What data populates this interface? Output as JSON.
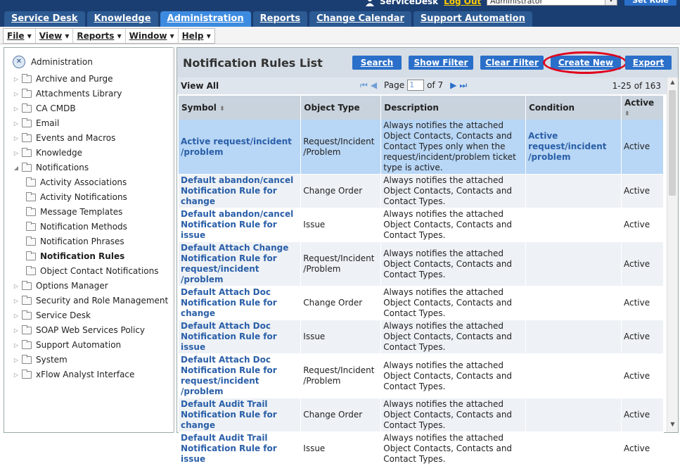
{
  "top": {
    "user": "ServiceDesk",
    "logout": "Log Out",
    "role": "Administrator",
    "set_role": "Set Role"
  },
  "tabs": [
    "Service Desk",
    "Knowledge",
    "Administration",
    "Reports",
    "Change Calendar",
    "Support Automation"
  ],
  "active_tab": "Administration",
  "menus": [
    "File",
    "View",
    "Reports",
    "Window",
    "Help"
  ],
  "sidebar": {
    "root": "Administration",
    "items": [
      {
        "label": "Archive and Purge",
        "level": 1
      },
      {
        "label": "Attachments Library",
        "level": 1
      },
      {
        "label": "CA CMDB",
        "level": 1
      },
      {
        "label": "Email",
        "level": 1
      },
      {
        "label": "Events and Macros",
        "level": 1
      },
      {
        "label": "Knowledge",
        "level": 1
      },
      {
        "label": "Notifications",
        "level": 1,
        "expanded": true
      },
      {
        "label": "Activity Associations",
        "level": 2
      },
      {
        "label": "Activity Notifications",
        "level": 2
      },
      {
        "label": "Message Templates",
        "level": 2
      },
      {
        "label": "Notification Methods",
        "level": 2
      },
      {
        "label": "Notification Phrases",
        "level": 2
      },
      {
        "label": "Notification Rules",
        "level": 2,
        "selected": true
      },
      {
        "label": "Object Contact Notifications",
        "level": 2
      },
      {
        "label": "Options Manager",
        "level": 1
      },
      {
        "label": "Security and Role Management",
        "level": 1
      },
      {
        "label": "Service Desk",
        "level": 1
      },
      {
        "label": "SOAP Web Services Policy",
        "level": 1
      },
      {
        "label": "Support Automation",
        "level": 1
      },
      {
        "label": "System",
        "level": 1
      },
      {
        "label": "xFlow Analyst Interface",
        "level": 1
      }
    ]
  },
  "main": {
    "title": "Notification Rules List",
    "buttons": {
      "search": "Search",
      "show_filter": "Show Filter",
      "clear_filter": "Clear Filter",
      "create_new": "Create New",
      "export": "Export"
    },
    "view_all": "View All",
    "page_label": "Page",
    "page_value": "1",
    "of_pages": "of 7",
    "range": "1-25 of 163"
  },
  "table": {
    "columns": [
      "Symbol",
      "Object Type",
      "Description",
      "Condition",
      "Active"
    ],
    "rows": [
      {
        "symbol": "Active request/incident /problem",
        "type": "Request/Incident /Problem",
        "desc": "Always notifies the attached Object Contacts, Contacts and Contact Types only when the request/incident/problem ticket type is active.",
        "cond": "Active request/incident /problem",
        "active": "Active"
      },
      {
        "symbol": "Default abandon/cancel Notification Rule for change",
        "type": "Change Order",
        "desc": "Always notifies the attached Object Contacts, Contacts and Contact Types.",
        "cond": "",
        "active": "Active"
      },
      {
        "symbol": "Default abandon/cancel Notification Rule for issue",
        "type": "Issue",
        "desc": "Always notifies the attached Object Contacts, Contacts and Contact Types.",
        "cond": "",
        "active": "Active"
      },
      {
        "symbol": "Default Attach Change Notification Rule for request/incident /problem",
        "type": "Request/Incident /Problem",
        "desc": "Always notifies the attached Object Contacts, Contacts and Contact Types.",
        "cond": "",
        "active": "Active"
      },
      {
        "symbol": "Default Attach Doc Notification Rule for change",
        "type": "Change Order",
        "desc": "Always notifies the attached Object Contacts, Contacts and Contact Types.",
        "cond": "",
        "active": "Active"
      },
      {
        "symbol": "Default Attach Doc Notification Rule for issue",
        "type": "Issue",
        "desc": "Always notifies the attached Object Contacts, Contacts and Contact Types.",
        "cond": "",
        "active": "Active"
      },
      {
        "symbol": "Default Attach Doc Notification Rule for request/incident /problem",
        "type": "Request/Incident /Problem",
        "desc": "Always notifies the attached Object Contacts, Contacts and Contact Types.",
        "cond": "",
        "active": "Active"
      },
      {
        "symbol": "Default Audit Trail Notification Rule for change",
        "type": "Change Order",
        "desc": "Always notifies the attached Object Contacts, Contacts and Contact Types.",
        "cond": "",
        "active": "Active"
      },
      {
        "symbol": "Default Audit Trail Notification Rule for issue",
        "type": "Issue",
        "desc": "Always notifies the attached Object Contacts, Contacts and Contact Types.",
        "cond": "",
        "active": "Active"
      }
    ]
  }
}
